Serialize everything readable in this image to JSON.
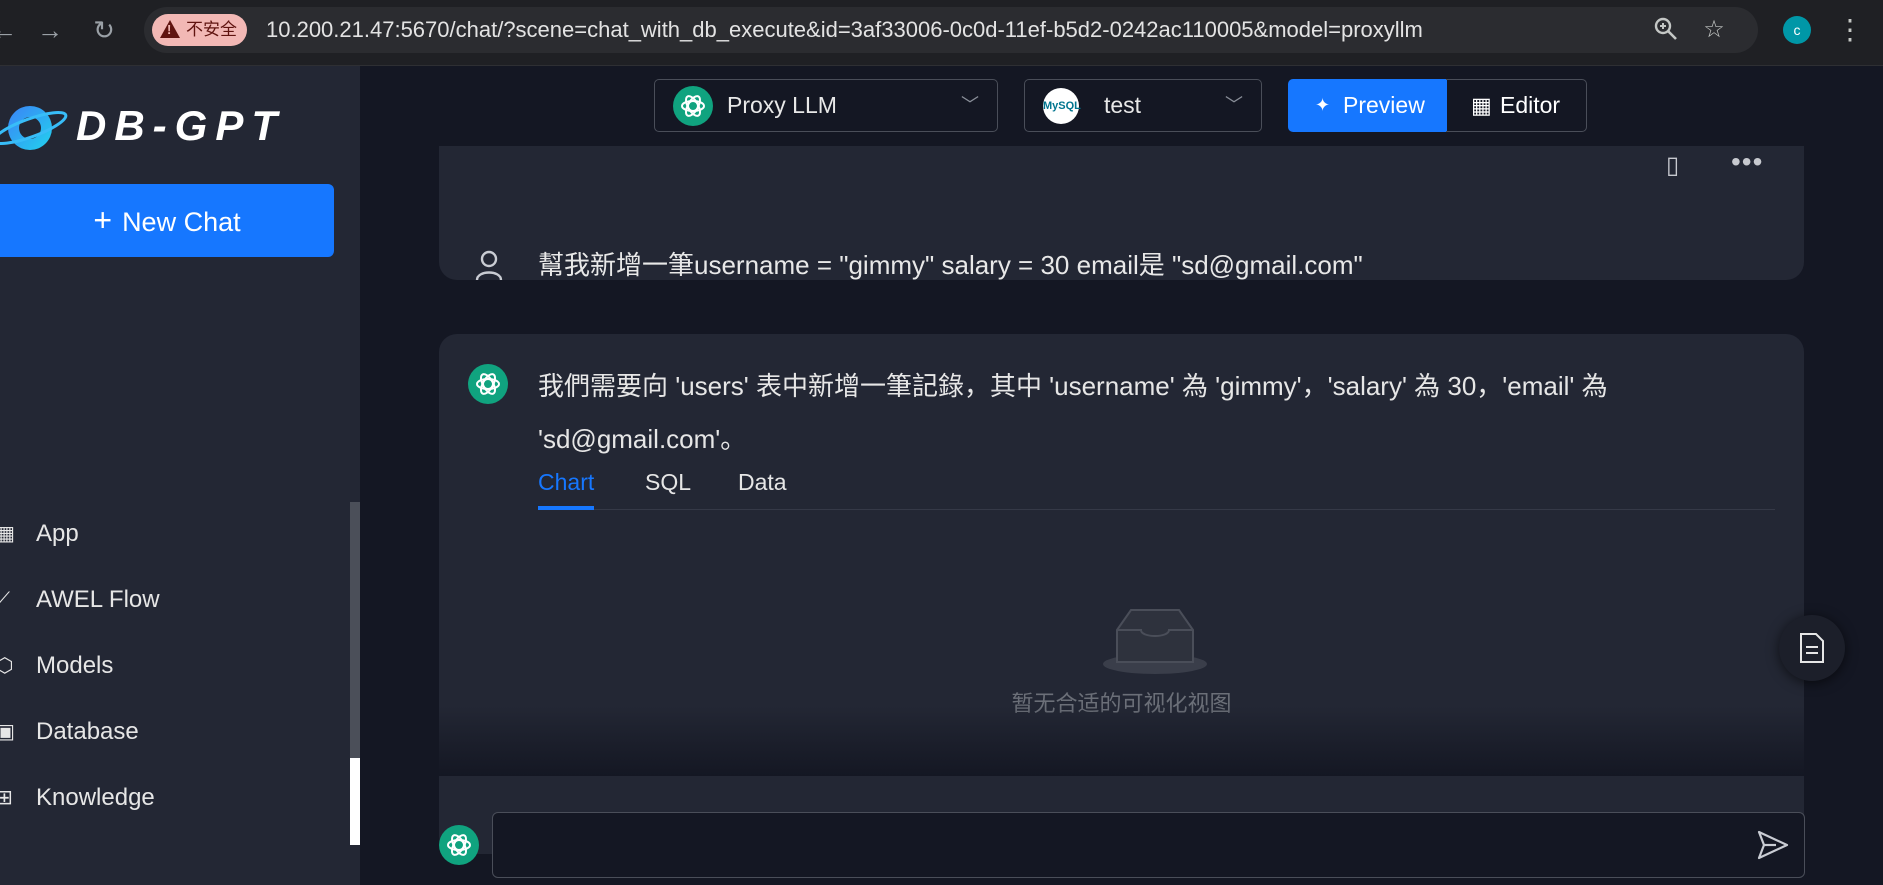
{
  "browser": {
    "security_label": "不安全",
    "url": "10.200.21.47:5670/chat/?scene=chat_with_db_execute&id=3af33006-0c0d-11ef-b5d2-0242ac110005&model=proxyllm",
    "profile_initial": "c",
    "icons": [
      "back-icon",
      "forward-icon",
      "reload-icon",
      "zoom-icon",
      "star-icon",
      "kebab-icon"
    ]
  },
  "sidebar": {
    "logo_text": "DB-GPT",
    "new_chat_label": "New Chat",
    "items": [
      {
        "label": "App",
        "icon": "app-icon"
      },
      {
        "label": "AWEL Flow",
        "icon": "flow-icon"
      },
      {
        "label": "Models",
        "icon": "models-icon"
      },
      {
        "label": "Database",
        "icon": "database-icon"
      },
      {
        "label": "Knowledge",
        "icon": "knowledge-icon"
      }
    ]
  },
  "toolbar": {
    "model_select": "Proxy LLM",
    "db_select": "test",
    "mysql_badge": "MySQL",
    "preview_label": "Preview",
    "editor_label": "Editor"
  },
  "conversation": {
    "user_message": "幫我新增一筆username = \"gimmy\" salary = 30 email是 \"sd@gmail.com\"",
    "ai_message": "我們需要向 'users' 表中新增一筆記錄，其中 'username' 為 'gimmy'，'salary' 為 30，'email' 為 'sd@gmail.com'。",
    "tabs": [
      "Chart",
      "SQL",
      "Data"
    ],
    "active_tab": "Chart",
    "empty_text": "暂无合适的可视化视图"
  },
  "input": {
    "value": "",
    "placeholder": ""
  },
  "colors": {
    "accent": "#1677ff",
    "sidebar_bg": "#232734",
    "main_bg": "#141723",
    "gpt_green": "#10a37f"
  }
}
